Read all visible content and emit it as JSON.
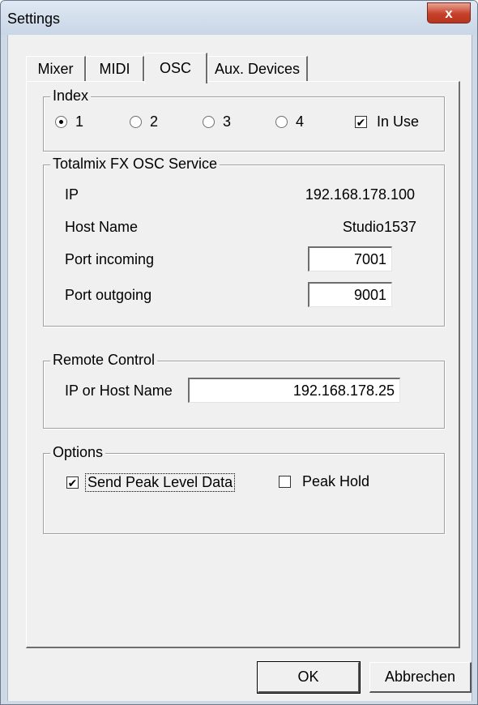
{
  "window": {
    "title": "Settings",
    "close_glyph": "x"
  },
  "tabs": [
    {
      "label": "Mixer",
      "active": false
    },
    {
      "label": "MIDI",
      "active": false
    },
    {
      "label": "OSC",
      "active": true
    },
    {
      "label": "Aux. Devices",
      "active": false
    }
  ],
  "index_group": {
    "title": "Index",
    "options": [
      "1",
      "2",
      "3",
      "4"
    ],
    "selected": "1",
    "in_use_label": "In Use",
    "in_use_checked": true
  },
  "osc_service": {
    "title": "Totalmix FX OSC Service",
    "ip_label": "IP",
    "ip_value": "192.168.178.100",
    "host_label": "Host Name",
    "host_value": "Studio1537",
    "port_in_label": "Port incoming",
    "port_in_value": "7001",
    "port_out_label": "Port outgoing",
    "port_out_value": "9001"
  },
  "remote_control": {
    "title": "Remote Control",
    "ip_host_label": "IP or Host Name",
    "ip_host_value": "192.168.178.25"
  },
  "options": {
    "title": "Options",
    "send_peak_label": "Send Peak Level Data",
    "send_peak_checked": true,
    "peak_hold_label": "Peak Hold",
    "peak_hold_checked": false
  },
  "buttons": {
    "ok": "OK",
    "cancel": "Abbrechen"
  },
  "icons": {
    "close": "close-icon",
    "check": "checkmark-icon"
  }
}
